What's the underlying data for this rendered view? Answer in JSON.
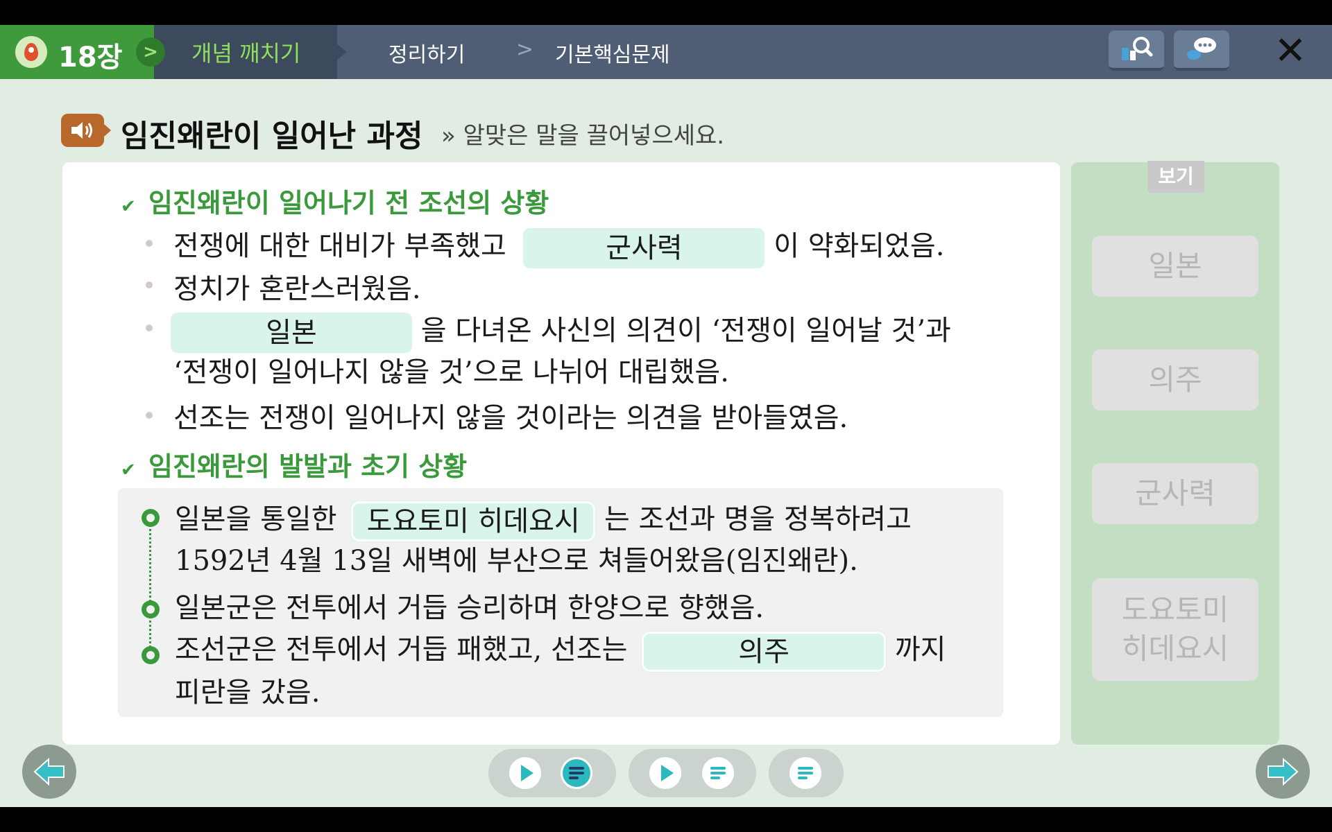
{
  "topbar": {
    "chapter": "18장",
    "tabs": [
      "개념 깨치기",
      "정리하기",
      "기본핵심문제"
    ],
    "separator": ">",
    "close_symbol": "✕"
  },
  "header": {
    "title": "임진왜란이 일어난 과정",
    "instruction": "» 알맞은 말을 끌어넣으세요."
  },
  "section1": {
    "heading": "임진왜란이 일어나기 전 조선의 상황",
    "line1_before": "전쟁에 대한 대비가 부족했고",
    "line1_blank": "군사력",
    "line1_after": "이 약화되었음.",
    "line2": "정치가 혼란스러웠음.",
    "line3_blank": "일본",
    "line3_after": "을 다녀온 사신의 의견이 ‘전쟁이 일어날 것’과",
    "line3_cont": "‘전쟁이 일어나지 않을 것’으로 나뉘어 대립했음.",
    "line4": "선조는 전쟁이 일어나지 않을 것이라는 의견을 받아들였음."
  },
  "section2": {
    "heading": "임진왜란의 발발과 초기 상황",
    "item1_before": "일본을 통일한",
    "item1_blank": "도요토미 히데요시",
    "item1_after": "는 조선과 명을 정복하려고",
    "item1_cont": "1592년 4월 13일 새벽에 부산으로 쳐들어왔음(임진왜란).",
    "item2": "일본군은 전투에서 거듭 승리하며 한양으로 향했음.",
    "item3_before": "조선군은 전투에서 거듭 패했고, 선조는",
    "item3_blank": "의주",
    "item3_after": "까지",
    "item3_cont": "피란을 갔음."
  },
  "side": {
    "label": "보기",
    "cards": [
      "일본",
      "의주",
      "군사력",
      "도요토미\n히데요시"
    ]
  },
  "icons": [
    "map-pin-icon",
    "chevron-right-icon",
    "search-icon",
    "chat-icon",
    "close-icon",
    "speaker-icon",
    "check-icon",
    "play-icon",
    "text-lines-icon",
    "arrow-left-icon",
    "arrow-right-icon"
  ],
  "colors": {
    "nav_bg": "#4f5e74",
    "chapter_bg": "#3f9a3c",
    "accent_green": "#3a9a3b",
    "blank_bg": "#d9f4ea",
    "teal": "#2cb8bf"
  }
}
